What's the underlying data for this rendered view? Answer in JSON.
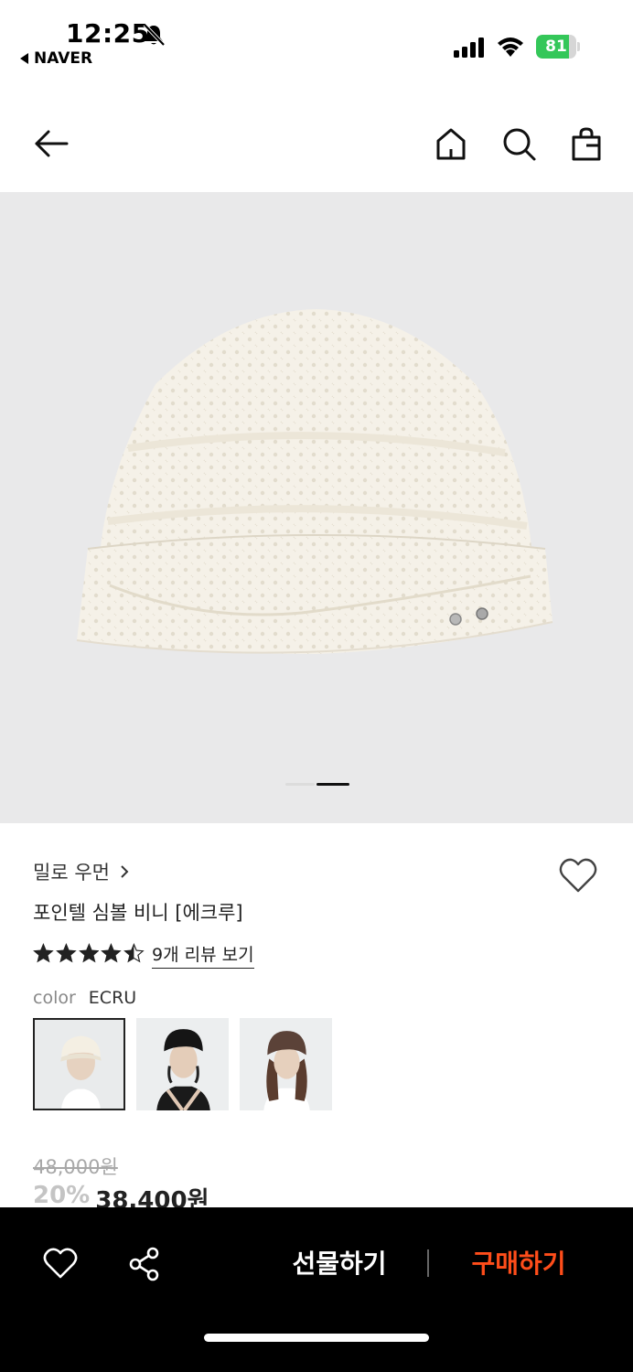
{
  "status_bar": {
    "time": "12:25",
    "back_app": "NAVER",
    "battery_percent": "81",
    "battery_level": 0.81,
    "icons": [
      "bell-slash-icon",
      "signal-icon",
      "wifi-icon",
      "battery-charging-icon"
    ]
  },
  "nav": {
    "icons": [
      "back-arrow-icon",
      "home-icon",
      "search-icon",
      "shopping-bag-icon"
    ]
  },
  "gallery": {
    "page_count": 2,
    "current_page": 2
  },
  "product": {
    "brand": "밀로 우먼",
    "title": "포인텔 심볼 비니 [에크루]",
    "rating": 4.5,
    "review_link": "9개 리뷰 보기",
    "color_label": "color",
    "color_value": "ECRU",
    "swatches": [
      "ecru",
      "black",
      "brown"
    ],
    "price_original": "48,000원",
    "discount": "20%",
    "price_sale": "38,400원"
  },
  "bottom_bar": {
    "gift_label": "선물하기",
    "buy_label": "구매하기",
    "icons": [
      "heart-icon",
      "share-icon"
    ]
  },
  "colors": {
    "accent": "#ff4d1a",
    "battery": "#34c759",
    "image_bg": "#e9e9ea",
    "hat_ecru": "#f5f1e8"
  }
}
